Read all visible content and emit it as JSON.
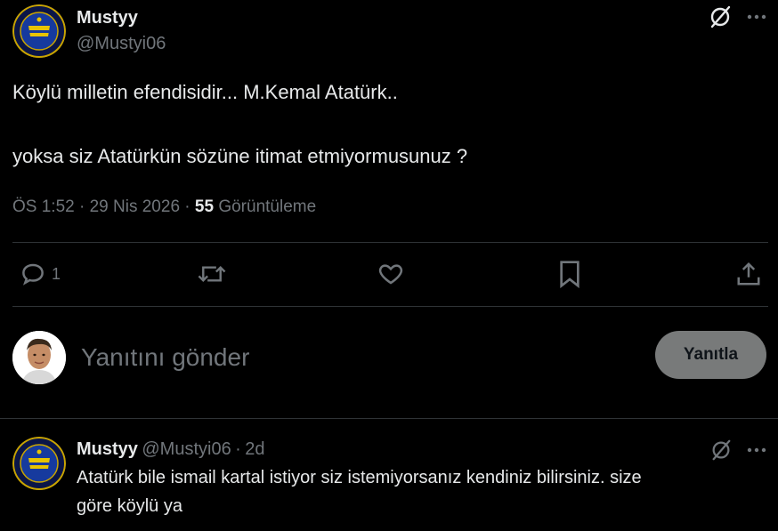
{
  "post": {
    "author_name": "Mustyy",
    "author_handle": "@Mustyi06",
    "text_line1": "Köylü milletin efendisidir... M.Kemal Atatürk..",
    "text_line2": "yoksa siz Atatürkün sözüne itimat etmiyormusunuz ?",
    "time": "ÖS 1:52",
    "date": "29 Nis 2026",
    "views_count": "55",
    "views_label": "Görüntüleme",
    "reply_count": "1"
  },
  "compose": {
    "placeholder": "Yanıtını gönder",
    "submit_label": "Yanıtla"
  },
  "reply": {
    "author_name": "Mustyy",
    "author_handle": "@Mustyi06",
    "age": "2d",
    "text_line1": "Atatürk bile ismail kartal istiyor siz istemiyorsanız kendiniz bilirsiniz. size",
    "text_line2": "göre köylü ya"
  },
  "separator": "·"
}
